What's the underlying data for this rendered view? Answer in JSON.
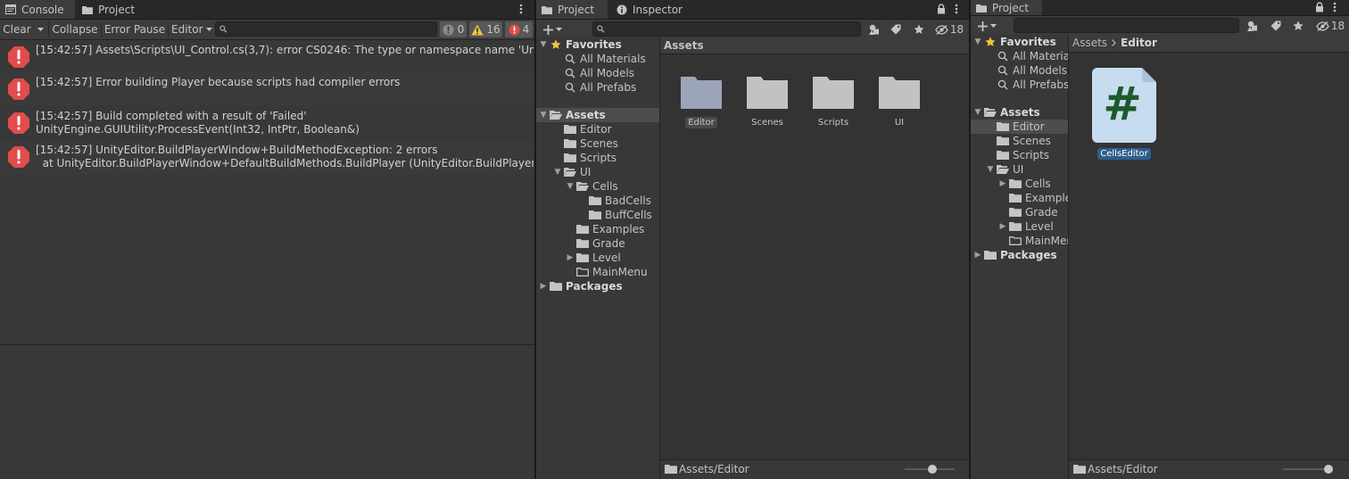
{
  "console": {
    "tabs": [
      {
        "label": "Console"
      },
      {
        "label": "Project"
      }
    ],
    "toolbar": {
      "clear": "Clear",
      "collapse": "Collapse",
      "error_pause": "Error Pause",
      "editor": "Editor",
      "search_placeholder": "",
      "info_count": "0",
      "warn_count": "16",
      "error_count": "4"
    },
    "logs": [
      {
        "text": "[15:42:57] Assets\\Scripts\\UI_Control.cs(3,7): error CS0246: The type or namespace name 'UnityEditor' could not be found"
      },
      {
        "text": "[15:42:57] Error building Player because scripts had compiler errors"
      },
      {
        "text": "[15:42:57] Build completed with a result of 'Failed'\nUnityEngine.GUIUtility:ProcessEvent(Int32, IntPtr, Boolean&)"
      },
      {
        "text": "[15:42:57] UnityEditor.BuildPlayerWindow+BuildMethodException: 2 errors\n  at UnityEditor.BuildPlayerWindow+DefaultBuildMethods.BuildPlayer (UnityEditor.BuildPlayerOptions options)"
      }
    ]
  },
  "project_mid": {
    "tabs": [
      {
        "label": "Project"
      },
      {
        "label": "Inspector"
      }
    ],
    "hidden_count": "18",
    "tree": {
      "favorites": "Favorites",
      "fav_items": [
        "All Materials",
        "All Models",
        "All Prefabs"
      ],
      "assets": "Assets",
      "editor": "Editor",
      "scenes": "Scenes",
      "scripts": "Scripts",
      "ui": "UI",
      "cells": "Cells",
      "badcells": "BadCells",
      "buffcells": "BuffCells",
      "examples": "Examples",
      "grade": "Grade",
      "level": "Level",
      "mainmenu": "MainMenu",
      "packages": "Packages"
    },
    "grid_header": "Assets",
    "grid_items": [
      "Editor",
      "Scenes",
      "Scripts",
      "UI"
    ],
    "footer_path": "Assets/Editor",
    "zoom_level": 0.55
  },
  "project_right": {
    "tabs": [
      {
        "label": "Project"
      }
    ],
    "hidden_count": "18",
    "tree": {
      "favorites": "Favorites",
      "fav_items": [
        "All Materials",
        "All Models",
        "All Prefabs"
      ],
      "assets": "Assets",
      "editor": "Editor",
      "scenes": "Scenes",
      "scripts": "Scripts",
      "ui": "UI",
      "cells": "Cells",
      "examples": "Examples",
      "grade": "Grade",
      "level": "Level",
      "mainmenu": "MainMenu",
      "packages": "Packages"
    },
    "breadcrumb": {
      "root": "Assets",
      "current": "Editor"
    },
    "file_item": "CellsEditor",
    "file_glyph": "#",
    "footer_path": "Assets/Editor",
    "zoom_level": 0.9
  },
  "colors": {
    "error": "#e24c4b",
    "warning": "#f0c33c",
    "selection": "#2f5d8c",
    "script_icon_bg": "#c7dcf0",
    "script_glyph": "#1e5a2c",
    "folder": "#c2c2c2",
    "folder_selected": "#9ca4b8"
  }
}
